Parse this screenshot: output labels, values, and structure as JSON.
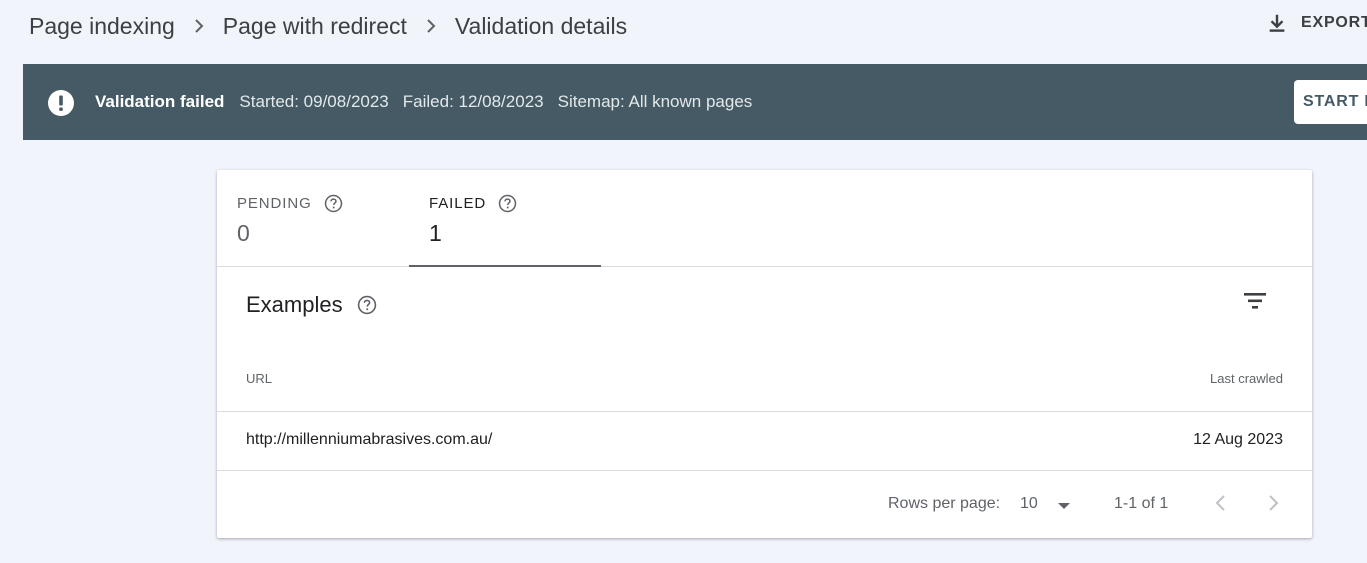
{
  "breadcrumb": {
    "items": [
      "Page indexing",
      "Page with redirect",
      "Validation details"
    ],
    "separator_icon": "chevron-right-icon"
  },
  "header": {
    "export_label": "EXPORT",
    "export_icon": "download-icon"
  },
  "status": {
    "icon": "error-icon",
    "title": "Validation failed",
    "started": "Started: 09/08/2023",
    "failed": "Failed: 12/08/2023",
    "sitemap": "Sitemap: All known pages",
    "button_label": "START NEW VALIDATION",
    "bar_color": "#455a64"
  },
  "tabs": [
    {
      "label": "PENDING",
      "count": "0",
      "selected": false
    },
    {
      "label": "FAILED",
      "count": "1",
      "selected": true
    }
  ],
  "examples": {
    "title": "Examples",
    "filter_icon": "filter-icon",
    "columns": {
      "url": "URL",
      "last_crawled": "Last crawled"
    },
    "rows": [
      {
        "url": "http://millenniumabrasives.com.au/",
        "last_crawled": "12 Aug 2023"
      }
    ]
  },
  "pagination": {
    "rows_per_page_label": "Rows per page:",
    "rows_per_page_value": "10",
    "range": "1-1 of 1"
  }
}
